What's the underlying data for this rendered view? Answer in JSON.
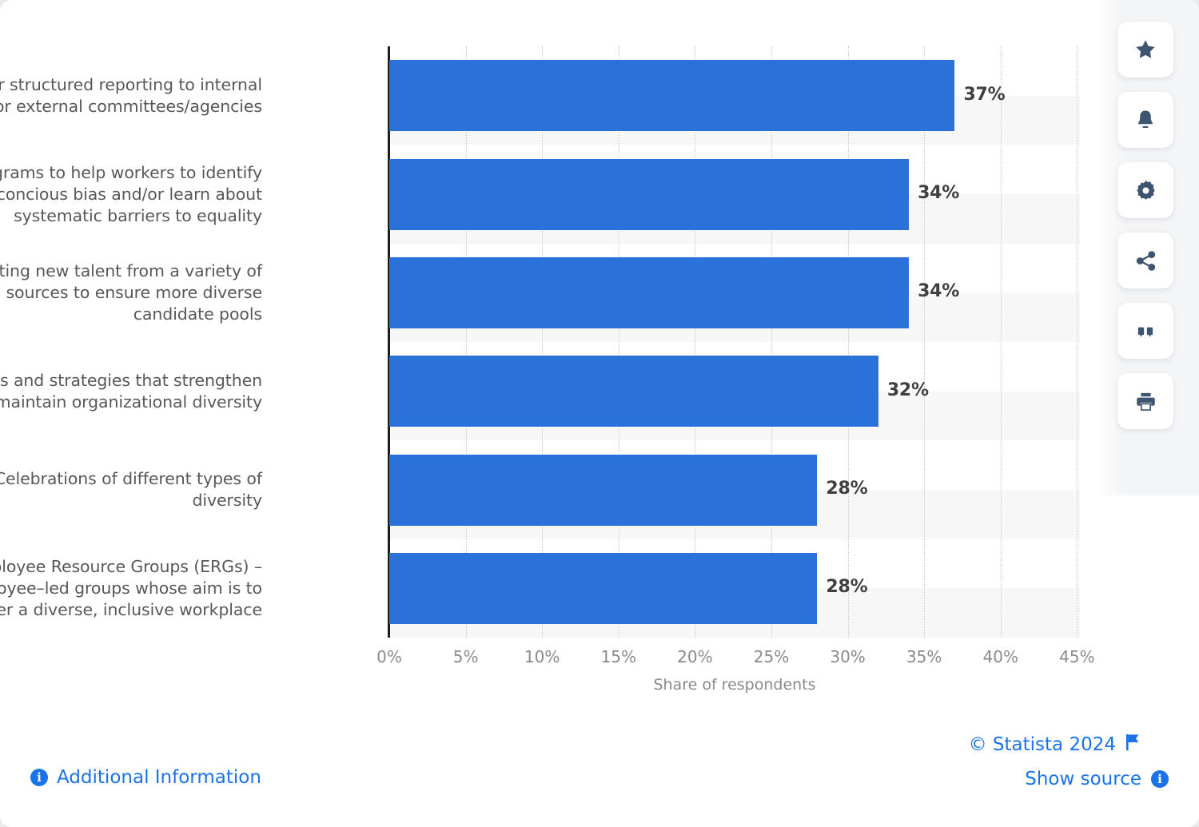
{
  "chart_data": {
    "type": "bar",
    "orientation": "horizontal",
    "title": "",
    "xlabel": "Share of respondents",
    "ylabel": "",
    "xlim": [
      0,
      45
    ],
    "xticks": [
      "0%",
      "5%",
      "10%",
      "15%",
      "20%",
      "25%",
      "30%",
      "35%",
      "40%",
      "45%"
    ],
    "xtick_values": [
      0,
      5,
      10,
      15,
      20,
      25,
      30,
      35,
      40,
      45
    ],
    "grid": "vertical-dotted",
    "legend": "none",
    "bar_color": "#2a72da",
    "categories": [
      "Regular structured reporting to internal or external committees/agencies",
      "Programs to help workers to identify unconcious bias and/or learn about systematic barriers to equality",
      "Recruiting new talent from a variety of sources to ensure more diverse candidate pools",
      "Policies and strategies that strengthen and maintain organizational diversity",
      "Celebrations of different types of diversity",
      "Employee Resource Groups (ERGs) – employee–led groups whose aim is to foster a diverse, inclusive workplace"
    ],
    "values": [
      37,
      34,
      34,
      32,
      28,
      28
    ],
    "value_labels": [
      "37%",
      "34%",
      "34%",
      "32%",
      "28%",
      "28%"
    ],
    "bars": [
      {
        "label_lines": [
          "Regular structured reporting to internal",
          "or external committees/agencies"
        ],
        "value": 37,
        "value_label": "37%"
      },
      {
        "label_lines": [
          "Programs to help workers to identify",
          "unconcious bias and/or learn about",
          "systematic barriers to equality"
        ],
        "value": 34,
        "value_label": "34%"
      },
      {
        "label_lines": [
          "Recruiting new talent from a variety of",
          "sources to ensure more diverse",
          "candidate pools"
        ],
        "value": 34,
        "value_label": "34%"
      },
      {
        "label_lines": [
          "Policies and strategies that strengthen",
          "and maintain organizational diversity"
        ],
        "value": 32,
        "value_label": "32%"
      },
      {
        "label_lines": [
          "Celebrations of different types of",
          "diversity"
        ],
        "value": 28,
        "value_label": "28%"
      },
      {
        "label_lines": [
          "Employee Resource Groups (ERGs) –",
          "employee–led groups whose aim is to",
          "foster a diverse, inclusive workplace"
        ],
        "value": 28,
        "value_label": "28%"
      }
    ]
  },
  "toolbar": {
    "items": [
      {
        "name": "favorite-icon",
        "title": "Add to favorites"
      },
      {
        "name": "bell-icon",
        "title": "Notifications"
      },
      {
        "name": "gear-icon",
        "title": "Settings"
      },
      {
        "name": "share-icon",
        "title": "Share"
      },
      {
        "name": "quote-icon",
        "title": "Cite"
      },
      {
        "name": "print-icon",
        "title": "Print"
      }
    ]
  },
  "footer": {
    "additional_information": "Additional Information",
    "copyright": "© Statista 2024",
    "show_source": "Show source",
    "info_glyph": "i"
  },
  "colors": {
    "bar": "#2a72da",
    "link": "#1a73e8",
    "icon": "#3e5571",
    "band": "#f7f7f7",
    "axis": "#1d1d1d",
    "label_text": "#58585a",
    "tick_text": "#8a8a8c"
  }
}
